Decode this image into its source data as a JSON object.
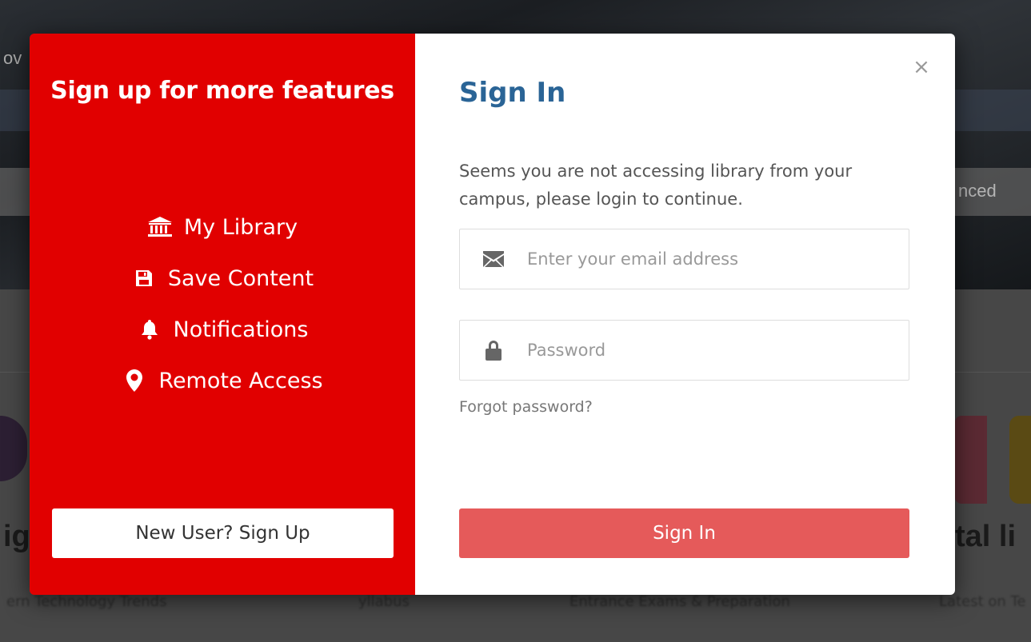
{
  "background": {
    "nav_fragment": "ov",
    "advanced_fragment": "nced",
    "left_heading_fragment": "ig",
    "right_heading_fragment": "tal li",
    "footer_items": [
      "ern Technology Trends",
      "yllabus",
      "Entrance Exams & Preparation",
      "Latest on Te"
    ]
  },
  "left_panel": {
    "title": "Sign up for more features",
    "features": [
      {
        "icon": "bank-icon",
        "label": "My Library"
      },
      {
        "icon": "floppy-disk-icon",
        "label": "Save Content"
      },
      {
        "icon": "bell-icon",
        "label": "Notifications"
      },
      {
        "icon": "map-marker-icon",
        "label": "Remote Access"
      }
    ],
    "signup_label": "New User? Sign Up",
    "accent_color": "#e10000"
  },
  "right_panel": {
    "close_label": "×",
    "title": "Sign In",
    "notice": "Seems you are not accessing library from your campus, please login to continue.",
    "email": {
      "placeholder": "Enter your email address",
      "value": "",
      "icon": "envelope-icon"
    },
    "password": {
      "placeholder": "Password",
      "value": "",
      "icon": "lock-icon"
    },
    "forgot_label": "Forgot password?",
    "signin_label": "Sign In",
    "title_color": "#2a6496",
    "button_color": "#e55a5a"
  }
}
